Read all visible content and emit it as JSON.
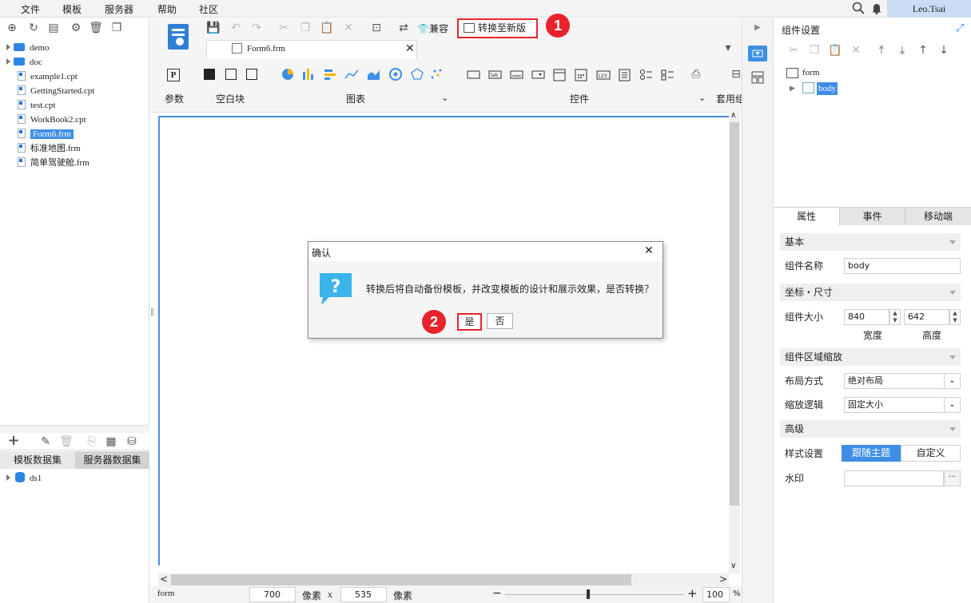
{
  "menu": [
    "文件",
    "模板",
    "服务器",
    "帮助",
    "社区"
  ],
  "user": "Leo.Tsai",
  "file_tree": [
    {
      "name": "demo",
      "type": "folder"
    },
    {
      "name": "doc",
      "type": "folder"
    },
    {
      "name": "example1.cpt",
      "type": "file"
    },
    {
      "name": "GettingStarted.cpt",
      "type": "file"
    },
    {
      "name": "test.cpt",
      "type": "file"
    },
    {
      "name": "WorkBook2.cpt",
      "type": "file"
    },
    {
      "name": "Form6.frm",
      "type": "file",
      "selected": true
    },
    {
      "name": "标准地图.frm",
      "type": "file"
    },
    {
      "name": "简单驾驶舱.frm",
      "type": "file"
    }
  ],
  "dataset_tabs": [
    "模板数据集",
    "服务器数据集"
  ],
  "datasets": [
    "ds1"
  ],
  "toolbar": {
    "compat_label": "兼容",
    "convert_label": "转换至新版"
  },
  "tab": {
    "name": "Form6.frm"
  },
  "ribbon": {
    "param": "参数",
    "blank": "空白块",
    "chart": "图表",
    "widget": "控件",
    "apply": "套用组"
  },
  "status": {
    "mode": "form",
    "width": "700",
    "unit1": "像素",
    "x": "x",
    "height": "535",
    "unit2": "像素",
    "zoom": "100",
    "percent": "%"
  },
  "right": {
    "title": "组件设置",
    "tree_root": "form",
    "tree_child": "body",
    "tabs": [
      "属性",
      "事件",
      "移动端"
    ],
    "basic": "基本",
    "name_label": "组件名称",
    "name_value": "body",
    "coord": "坐标・尺寸",
    "size_label": "组件大小",
    "width": "840",
    "height": "642",
    "width_label": "宽度",
    "height_label": "高度",
    "zoom_sect": "组件区域缩放",
    "layout_label": "布局方式",
    "layout_value": "绝对布局",
    "scale_label": "缩放逻辑",
    "scale_value": "固定大小",
    "advanced": "高级",
    "style_label": "样式设置",
    "style_opt1": "跟随主题",
    "style_opt2": "自定义",
    "watermark_label": "水印",
    "watermark_more": "···"
  },
  "dialog": {
    "title": "确认",
    "message": "转换后将自动备份模板，并改变模板的设计和展示效果，是否转换？",
    "yes": "是",
    "no": "否",
    "icon_glyph": "?"
  },
  "badges": [
    "1",
    "2"
  ],
  "colors": {
    "accent": "#3d8fe6",
    "highlight": "#e8232b"
  }
}
